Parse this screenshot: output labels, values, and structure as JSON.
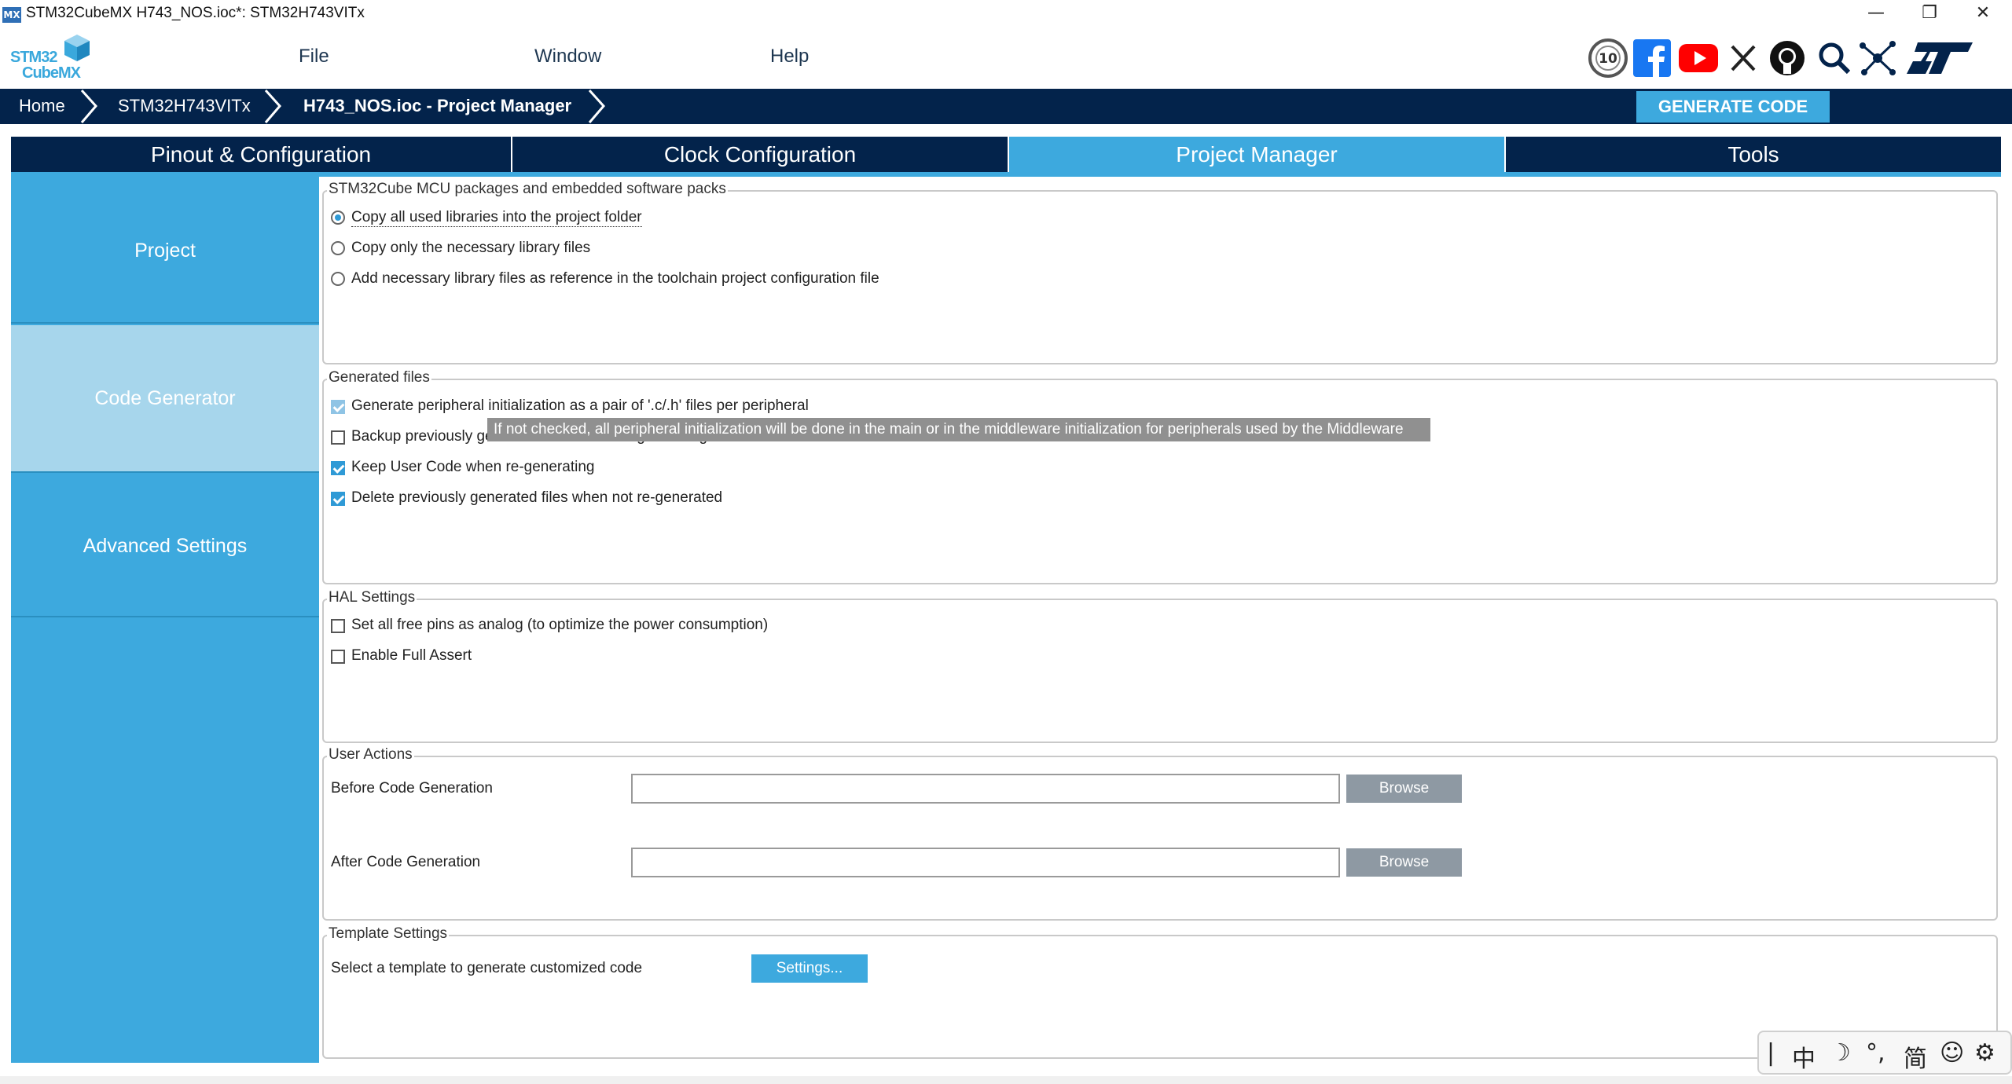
{
  "window": {
    "icon_text": "MX",
    "title": "STM32CubeMX H743_NOS.ioc*: STM32H743VITx",
    "minimize": "—",
    "restore": "❐",
    "close": "✕"
  },
  "header": {
    "logo_line1": "STM32",
    "logo_line2": "CubeMX",
    "menu": [
      "File",
      "Window",
      "Help"
    ],
    "social_icons": [
      "anniversary-10-icon",
      "facebook-icon",
      "youtube-icon",
      "x-icon",
      "github-icon",
      "search-icon",
      "network-icon",
      "st-logo-icon"
    ]
  },
  "breadcrumb": {
    "items": [
      "Home",
      "STM32H743VITx",
      "H743_NOS.ioc - Project Manager"
    ],
    "generate_label": "GENERATE CODE"
  },
  "tabs": [
    {
      "label": "Pinout & Configuration",
      "active": false
    },
    {
      "label": "Clock Configuration",
      "active": false
    },
    {
      "label": "Project Manager",
      "active": true
    },
    {
      "label": "Tools",
      "active": false
    }
  ],
  "sidebar": {
    "items": [
      {
        "label": "Project",
        "active": false
      },
      {
        "label": "Code Generator",
        "active": true
      },
      {
        "label": "Advanced Settings",
        "active": false
      }
    ]
  },
  "packs_group": {
    "legend": "STM32Cube MCU packages and embedded software packs",
    "options": [
      {
        "label": "Copy all used libraries into the project folder",
        "selected": true
      },
      {
        "label": "Copy only the necessary library files",
        "selected": false
      },
      {
        "label": "Add necessary library files as reference in the toolchain project configuration file",
        "selected": false
      }
    ]
  },
  "generated_group": {
    "legend": "Generated files",
    "options": [
      {
        "label": "Generate peripheral initialization as a pair of '.c/.h' files per peripheral",
        "checked": true
      },
      {
        "label": "Backup previously generated files when re-generating",
        "checked": false
      },
      {
        "label": "Keep User Code when re-generating",
        "checked": true
      },
      {
        "label": "Delete previously generated files when not re-generated",
        "checked": true
      }
    ],
    "tooltip": "If not checked, all peripheral initialization will be done in the main or in the middleware initialization for peripherals used by the Middleware"
  },
  "hal_group": {
    "legend": "HAL Settings",
    "options": [
      {
        "label": "Set all free pins as analog (to optimize the power consumption)",
        "checked": false
      },
      {
        "label": "Enable Full Assert",
        "checked": false
      }
    ]
  },
  "user_actions": {
    "legend": "User Actions",
    "before_label": "Before Code Generation",
    "before_value": "",
    "after_label": "After Code Generation",
    "after_value": "",
    "browse_label": "Browse"
  },
  "template_group": {
    "legend": "Template Settings",
    "label": "Select a template to generate customized code",
    "button": "Settings..."
  },
  "ime_toolbar": {
    "items": [
      "|",
      "中",
      "☽",
      "°,",
      "简",
      "☺",
      "⚙"
    ]
  },
  "colors": {
    "navy": "#03234b",
    "accent": "#3da9de",
    "sidebar_active": "#a7d6ec"
  }
}
